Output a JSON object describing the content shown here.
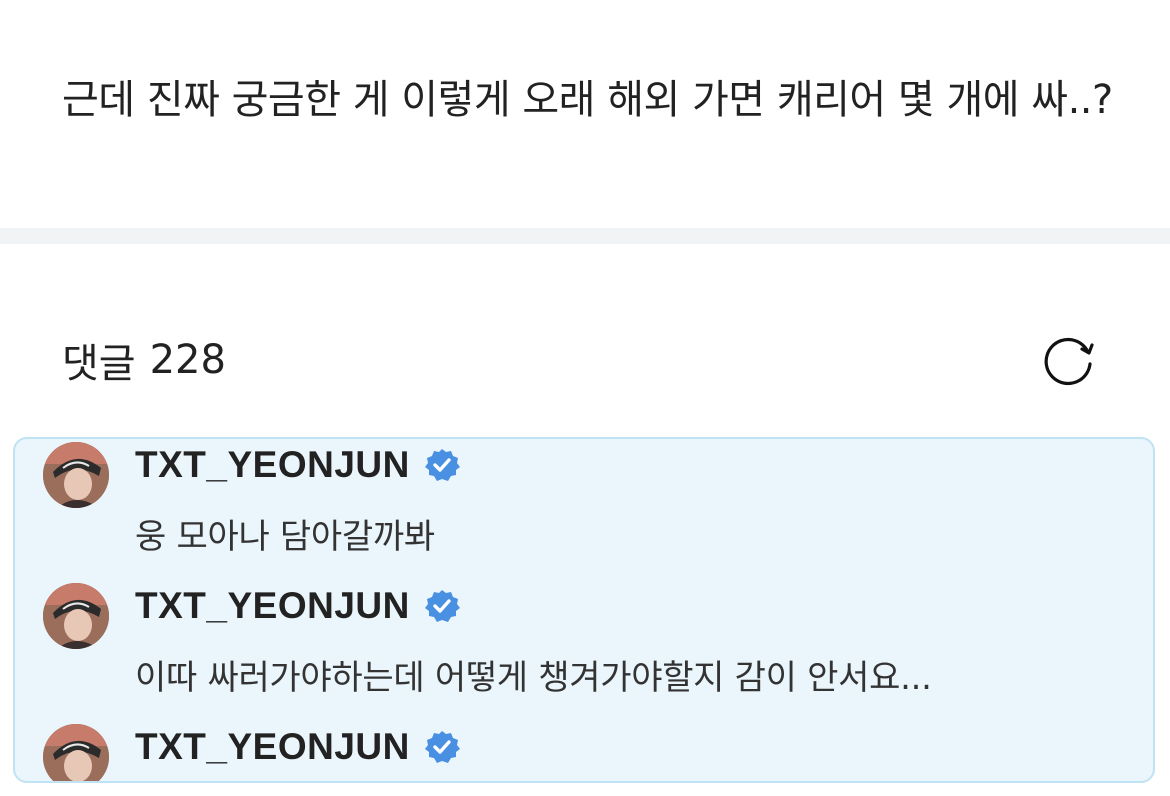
{
  "post": {
    "body": "근데 진짜 궁금한 게 이렇게 오래 해외 가면 캐리어 몇 개에 싸..?"
  },
  "comments_section": {
    "label": "댓글",
    "count": "228",
    "refresh_icon": "refresh-icon"
  },
  "highlighted_comments": [
    {
      "author": "TXT_YEONJUN",
      "verified": true,
      "text": "웅 모아나 담아갈까봐"
    },
    {
      "author": "TXT_YEONJUN",
      "verified": true,
      "text": "이따 싸러가야하는데 어떻게 챙겨가야할지 감이 안서요..."
    },
    {
      "author": "TXT_YEONJUN",
      "verified": true,
      "text": ""
    }
  ],
  "colors": {
    "highlight_background": "#eaf6fc",
    "highlight_border": "#bfe3f2",
    "verified_badge": "#4a90e2",
    "divider": "#f2f3f5"
  }
}
